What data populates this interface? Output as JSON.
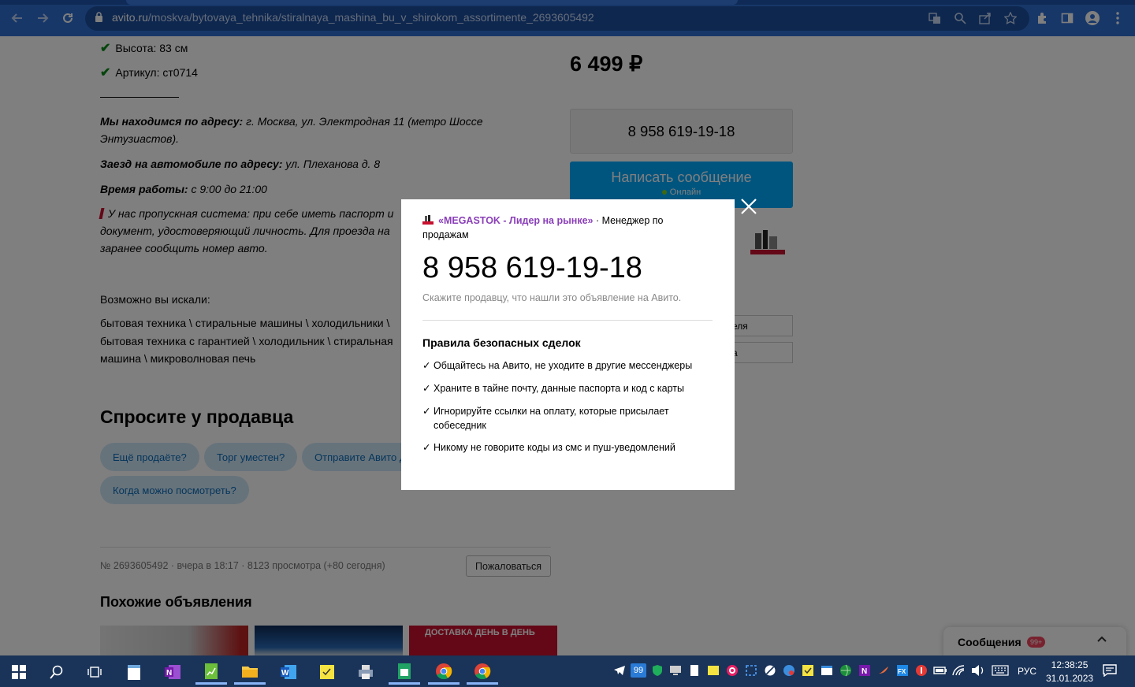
{
  "browser": {
    "url_host": "avito.ru",
    "url_path": "/moskva/bytovaya_tehnika/stiralnaya_mashina_bu_v_shirokom_assortimente_2693605492"
  },
  "listing": {
    "specs": [
      "Высота: 83 см",
      "Артикул: ст0714"
    ],
    "address_label": "Мы находимся по адресу:",
    "address_value": " г. Москва, ул. Электродная 11 (метро Шоссе Энтузиастов).",
    "car_label": "Заезд на автомобиле по адресу:",
    "car_value": " ул. Плеханова д. 8",
    "hours_label": "Время работы:",
    "hours_value": " с 9:00 до 21:00",
    "pass_line1": "У нас пропускная система: при себе иметь паспорт и",
    "pass_line2": "документ, удостоверяющий личность. Для проезда на",
    "pass_line3": "заранее сообщить номер авто.",
    "maybe_title": "Возможно вы искали:",
    "maybe_line1": "бытовая техника \\ стиральные машины \\ холодильники \\",
    "maybe_line2": "бытовая техника с гарантией \\ холодильник \\ стиральная",
    "maybe_line3": "машина \\ микроволновая печь"
  },
  "ask": {
    "title": "Спросите у продавца",
    "chips": [
      "Ещё продаёте?",
      "Торг уместен?",
      "Отправите Авито Доставкой?",
      "Когда можно посмотреть?"
    ]
  },
  "meta": {
    "text": "№ 2693605492 · вчера в 18:17 · 8123 просмотра (+80 сегодня)",
    "report_label": "Пожаловаться"
  },
  "similar_title": "Похожие объявления",
  "thumb3_text": "ДОСТАВКА ДЕНЬ В ДЕНЬ",
  "sidebar": {
    "price": "6 499 ₽",
    "phone": "8 958 619-19-18",
    "message_label": "Написать сообщение",
    "online_label": "Онлайн",
    "input1": "еля",
    "input2": "а"
  },
  "messages_bar": {
    "label": "Сообщения",
    "badge": "99+"
  },
  "modal": {
    "store_name": "«MEGASTOK - Лидер на рынке»",
    "role": " · Менеджер по продажам",
    "phone": "8 958 619-19-18",
    "hint": "Скажите продавцу, что нашли это объявление на Авито.",
    "rules_title": "Правила безопасных сделок",
    "rules": [
      "Общайтесь на Авито, не уходите в другие мессенджеры",
      "Храните в тайне почту, данные паспорта и код с карты",
      "Игнорируйте ссылки на оплату, которые присылает собеседник",
      "Никому не говорите коды из смс и пуш-уведомлений"
    ],
    "check_mark": "✓"
  },
  "taskbar": {
    "tray_badge": "99",
    "lang": "РУС",
    "time": "12:38:25",
    "date": "31.01.2023"
  }
}
